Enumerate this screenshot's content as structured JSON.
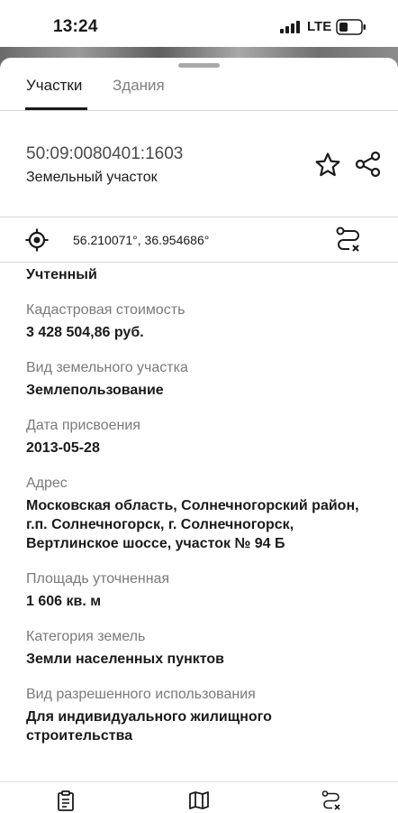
{
  "status_bar": {
    "time": "13:24",
    "network": "LTE"
  },
  "tabs": [
    {
      "label": "Участки",
      "active": true
    },
    {
      "label": "Здания",
      "active": false
    }
  ],
  "parcel": {
    "cadastral_number": "50:09:0080401:1603",
    "type": "Земельный участок"
  },
  "coordinates": "56.210071°, 36.954686°",
  "fields": {
    "status_value": "Учтенный",
    "cost_label": "Кадастровая стоимость",
    "cost_value": "3 428 504,86 руб.",
    "kind_label": "Вид земельного участка",
    "kind_value": "Землепользование",
    "date_label": "Дата присвоения",
    "date_value": "2013-05-28",
    "address_label": "Адрес",
    "address_value": "Московская область, Солнечногорский район, г.п. Солнечногорск, г. Солнечногорск, Вертлинское шоссе, участок № 94 Б",
    "area_label": "Площадь уточненная",
    "area_value": "1 606 кв. м",
    "category_label": "Категория земель",
    "category_value": "Земли населенных пунктов",
    "usage_label": "Вид разрешенного использования",
    "usage_value": "Для индивидуального жилищного строительства"
  },
  "icons": {
    "favorite": "star-icon",
    "share": "share-icon",
    "locate": "crosshair-icon",
    "route": "route-clear-icon",
    "nav_details": "clipboard-icon",
    "nav_map": "map-icon",
    "nav_route": "route-clear-icon"
  },
  "colors": {
    "text": "#1a1a1a",
    "secondary": "#7a7a7a",
    "divider": "#d6d6d6"
  }
}
